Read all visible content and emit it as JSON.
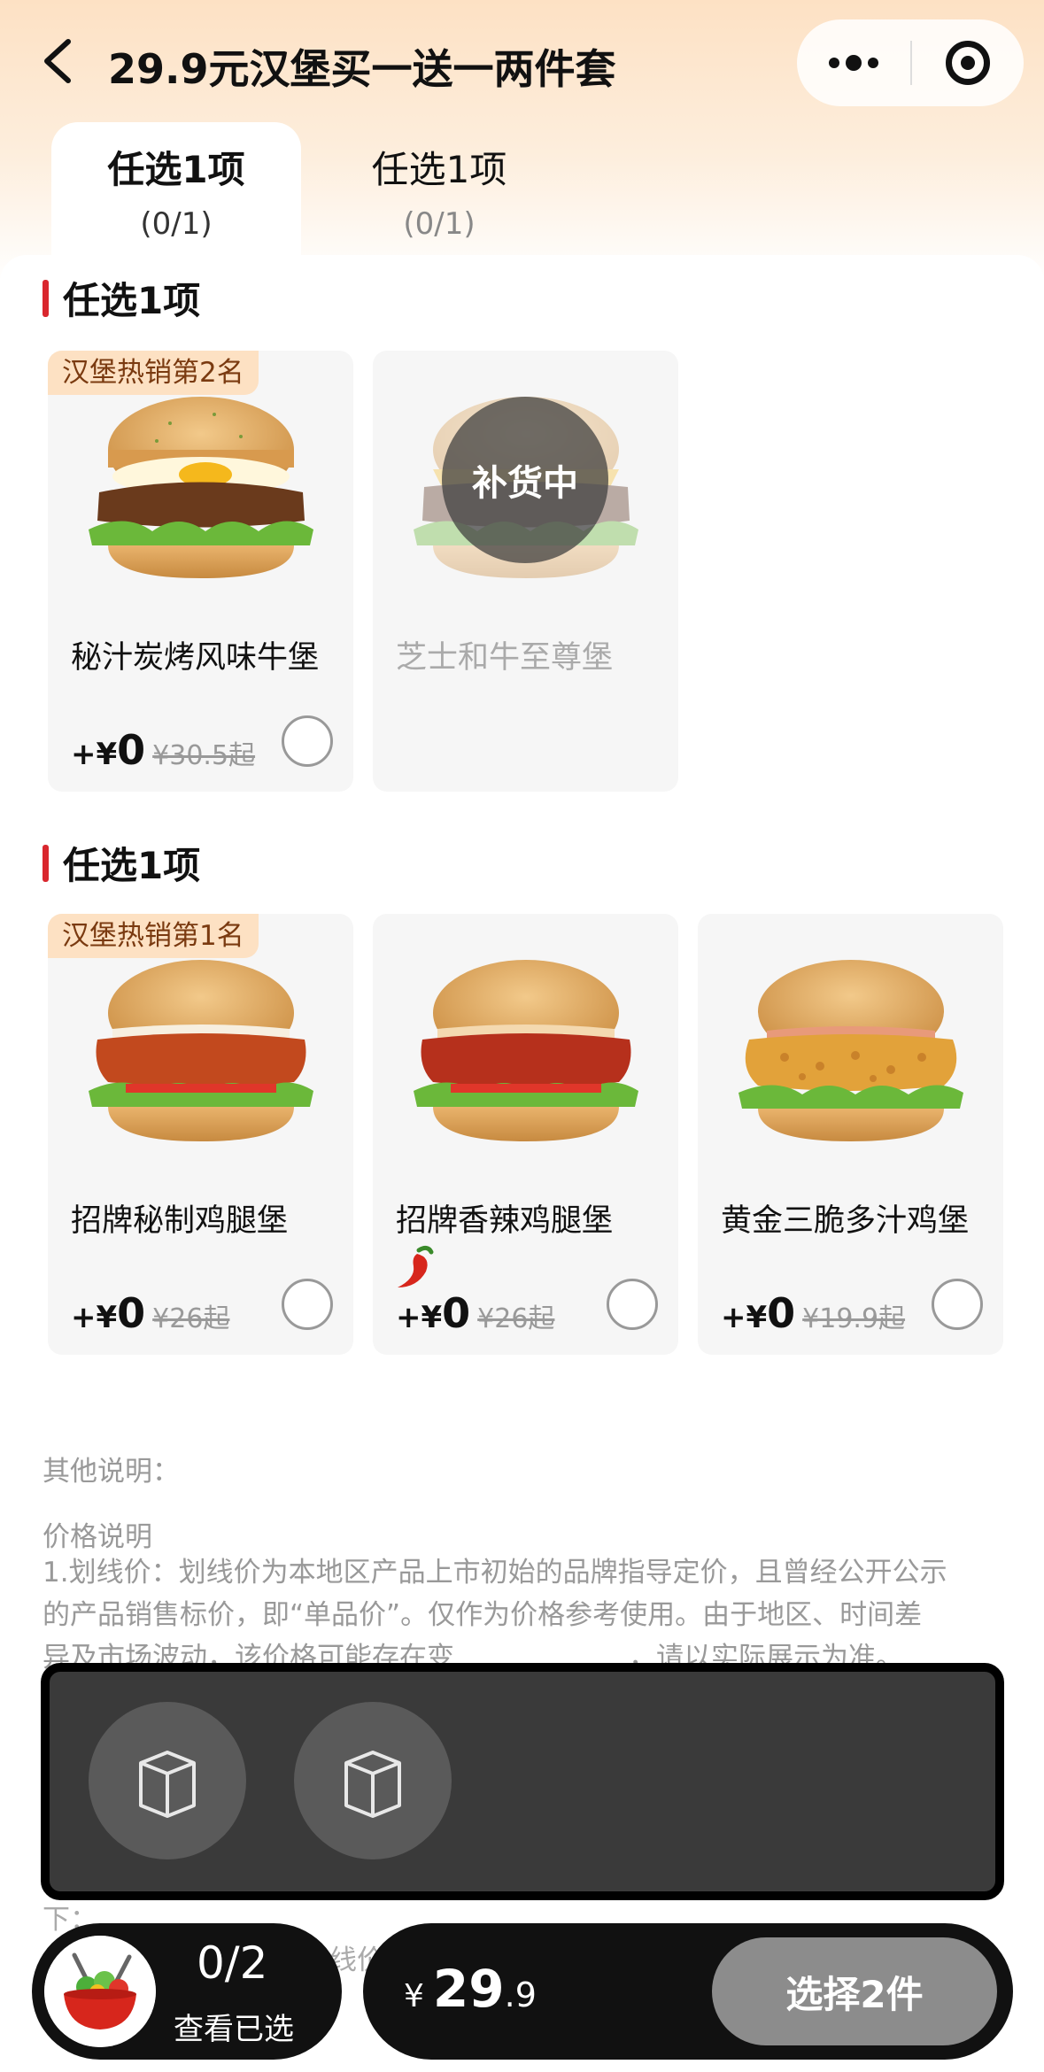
{
  "header": {
    "title": "29.9元汉堡买一送一两件套",
    "back_icon": "chevron-left-icon",
    "more_icon": "more-dots-icon",
    "close_icon": "target-circle-icon"
  },
  "tabs": [
    {
      "label": "任选1项",
      "count": "(0/1)",
      "active": true
    },
    {
      "label": "任选1项",
      "count": "(0/1)",
      "active": false
    }
  ],
  "sections": [
    {
      "title": "任选1项",
      "items": [
        {
          "badge": "汉堡热销第2名",
          "name": "秘汁炭烤风味牛堡",
          "plus": "+¥",
          "amount": "0",
          "orig": "¥30.5起",
          "status": "available"
        },
        {
          "badge": "",
          "name": "芝士和牛至尊堡",
          "overlay": "补货中",
          "status": "restocking"
        }
      ]
    },
    {
      "title": "任选1项",
      "items": [
        {
          "badge": "汉堡热销第1名",
          "name": "招牌秘制鸡腿堡",
          "plus": "+¥",
          "amount": "0",
          "orig": "¥26起",
          "status": "available"
        },
        {
          "badge": "",
          "name": "招牌香辣鸡腿堡",
          "plus": "+¥",
          "amount": "0",
          "orig": "¥26起",
          "spicy_icon": "chili-pepper-icon",
          "status": "available"
        },
        {
          "badge": "",
          "name": "黄金三脆多汁鸡堡",
          "plus": "+¥",
          "amount": "0",
          "orig": "¥19.9起",
          "status": "available"
        }
      ]
    }
  ],
  "notes": {
    "other": "其他说明：",
    "price_title": "价格说明",
    "line1": "1.划线价：划线价为本地区产品上市初始的品牌指导定价，且曾经公开公示",
    "line2": "的产品销售标价，即“单品价”。仅作为价格参考使用。由于地区、时间差",
    "line3": "异及市场波动，该价格可能存在变",
    "line3b": "，请以实际展示为准。",
    "trail1": "下：",
    "trail2": "线价"
  },
  "cart": {
    "slot_icon": "package-box-icon",
    "selected": "0/2",
    "view_label": "查看已选",
    "currency": "¥",
    "price_int": "29",
    "price_dec": ".9",
    "button": "选择2件"
  },
  "colors": {
    "accent_red": "#d9272e",
    "badge_bg": "#fde1c3",
    "header_gradient_top": "#fde1c4",
    "button_disabled": "#8c8c8c"
  }
}
